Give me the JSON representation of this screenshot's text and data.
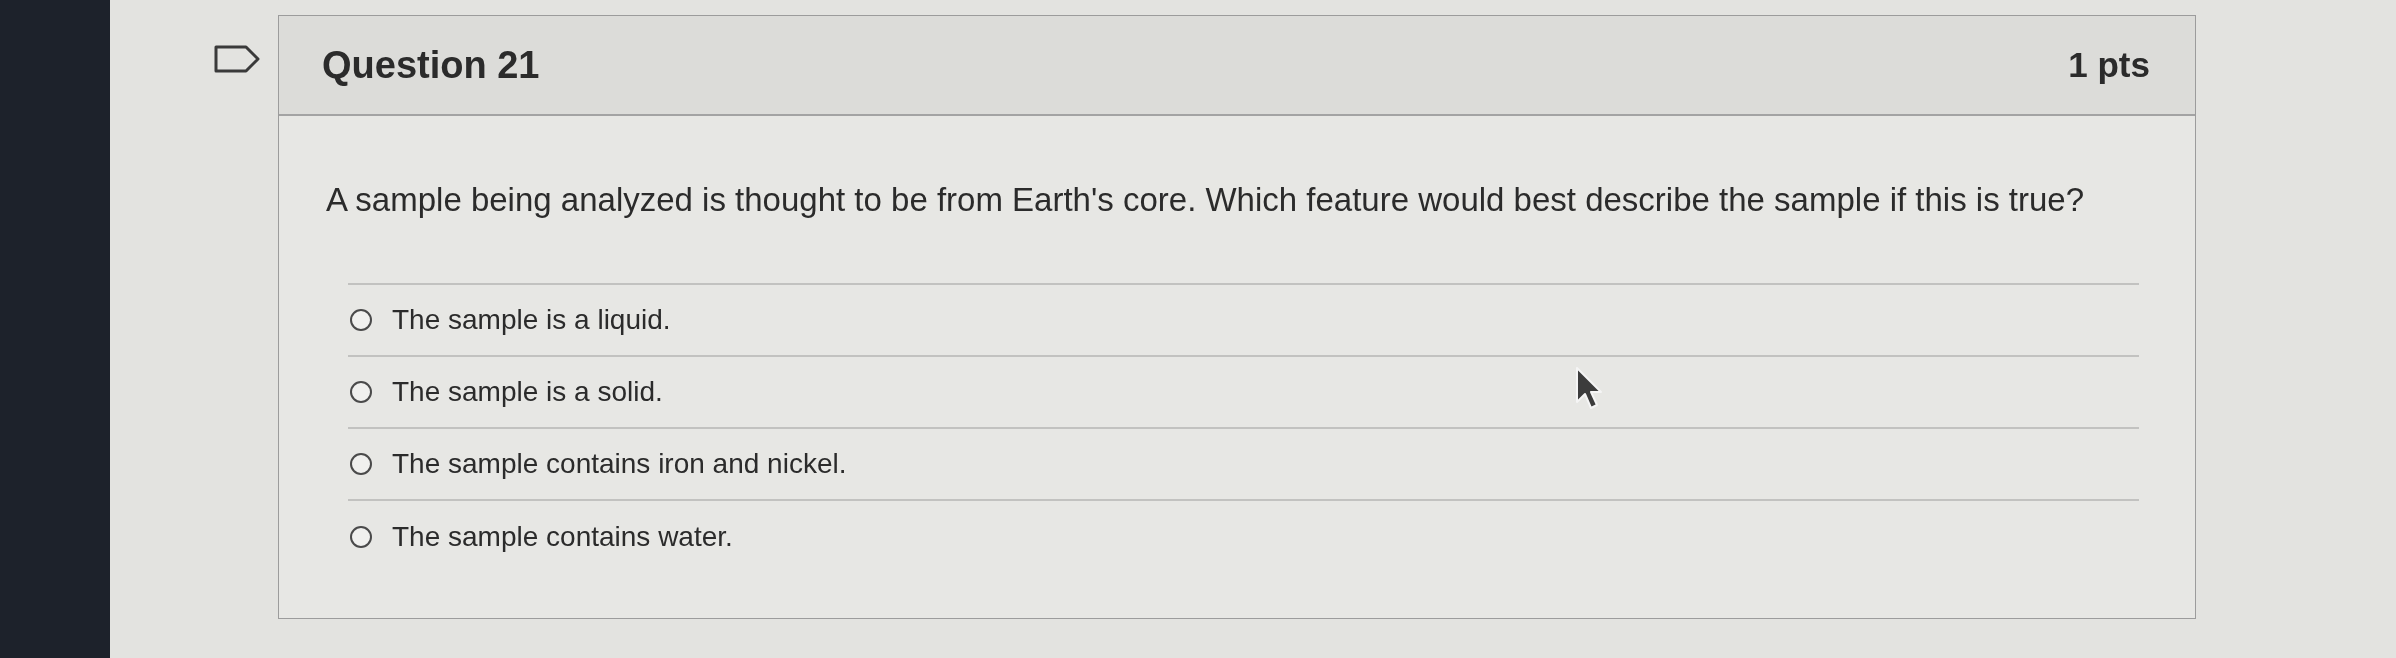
{
  "question": {
    "flagged": false,
    "title": "Question 21",
    "points": "1 pts",
    "text": "A sample being analyzed is thought to be from Earth's core. Which feature would best describe the sample if this is true?",
    "answers": [
      {
        "label": "The sample is a liquid.",
        "selected": false
      },
      {
        "label": "The sample is a solid.",
        "selected": false
      },
      {
        "label": "The sample contains iron and nickel.",
        "selected": false
      },
      {
        "label": "The sample contains water.",
        "selected": false
      }
    ]
  }
}
